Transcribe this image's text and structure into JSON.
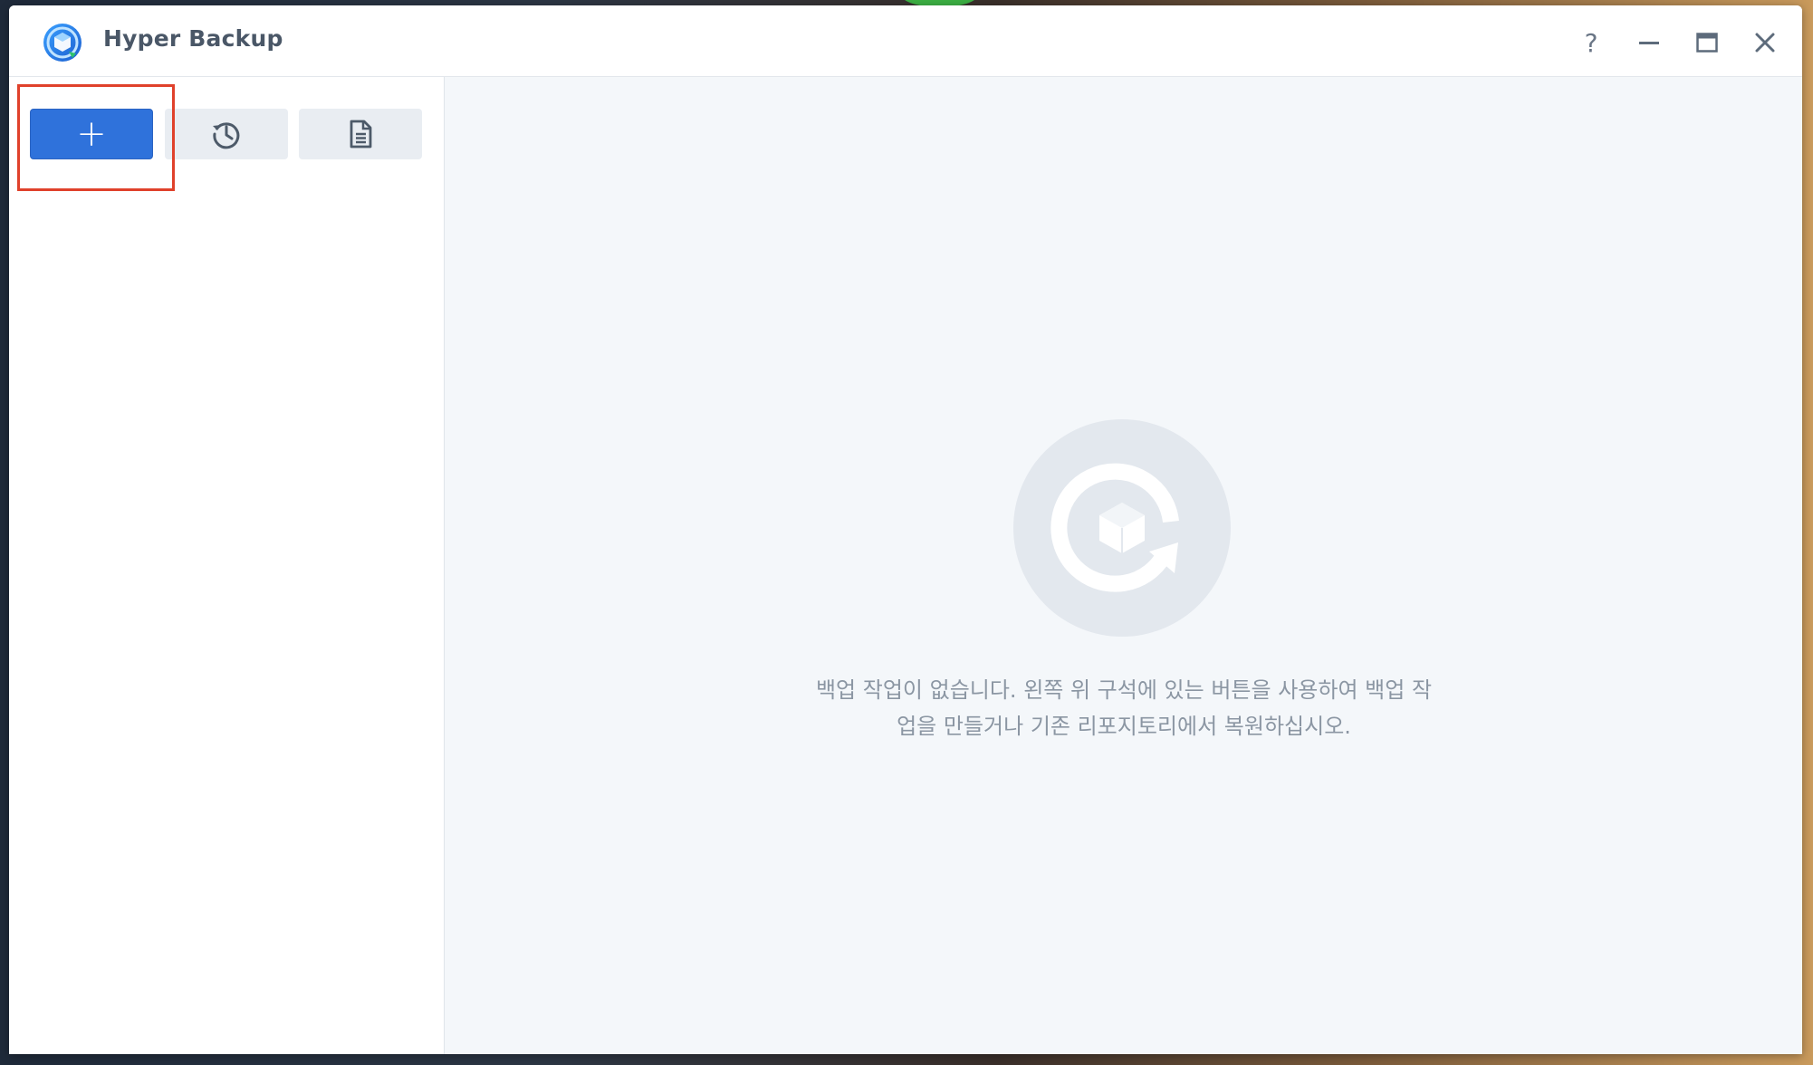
{
  "window": {
    "title": "Hyper Backup"
  },
  "controls": {
    "help_label": "?"
  },
  "toolbar": {
    "add_label": "+"
  },
  "main": {
    "empty_message": "백업 작업이 없습니다. 왼쪽 위 구석에 있는 버튼을 사용하여 백업 작업을 만들거나 기존 리포지토리에서 복원하십시오."
  },
  "icons": {
    "app": "hyper-backup-logo-icon",
    "help": "help-icon",
    "minimize": "minimize-icon",
    "maximize": "maximize-icon",
    "close": "close-icon",
    "add": "plus-icon",
    "restore": "history-icon",
    "log": "document-icon",
    "empty": "backup-empty-icon"
  },
  "colors": {
    "accent": "#2f72db",
    "highlight": "#e0412b",
    "title_text": "#4a5767",
    "muted_text": "#8b96a3",
    "panel_bg": "#f4f7fa",
    "button_bg": "#e9edf2"
  }
}
